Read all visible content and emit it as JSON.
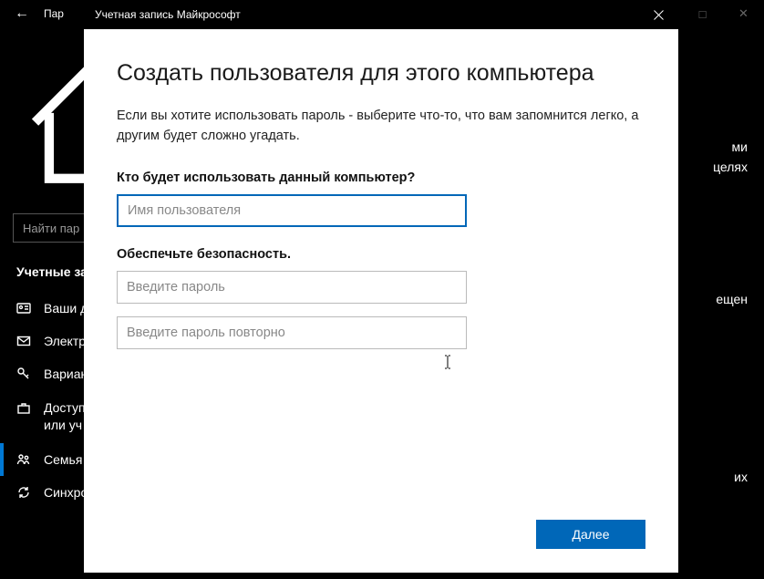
{
  "bgWindow": {
    "title": "Пар",
    "search_placeholder": "Найти пар",
    "home_label": "Главна",
    "section_title": "Учетные за",
    "items": [
      {
        "label": "Ваши д"
      },
      {
        "label": "Электр"
      },
      {
        "label": "Вариан"
      },
      {
        "label": "Доступ\nили уч"
      },
      {
        "label": "Семья"
      },
      {
        "label": "Синхро"
      }
    ],
    "right_snippet1_line1": "ми",
    "right_snippet1_line2": "целях",
    "right_snippet2": "ещен",
    "right_snippet4": "их"
  },
  "dialog": {
    "title": "Учетная запись Майкрософт",
    "heading": "Создать пользователя для этого компьютера",
    "description": "Если вы хотите использовать пароль - выберите что-то, что вам запомнится легко, а другим будет сложно угадать.",
    "question1": "Кто будет использовать данный компьютер?",
    "username_placeholder": "Имя пользователя",
    "section_label": "Обеспечьте безопасность.",
    "password_placeholder": "Введите пароль",
    "password2_placeholder": "Введите пароль повторно",
    "next_button": "Далее"
  }
}
